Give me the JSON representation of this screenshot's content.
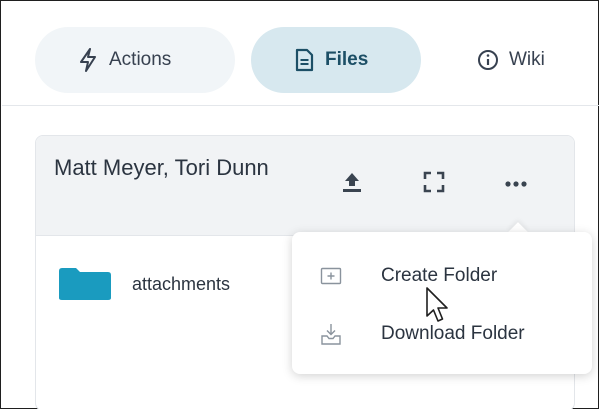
{
  "tabs": [
    {
      "label": "Actions",
      "icon": "lightning-icon",
      "active": false
    },
    {
      "label": "Files",
      "icon": "file-icon",
      "active": true
    },
    {
      "label": "Wiki",
      "icon": "info-icon",
      "active": false
    }
  ],
  "card": {
    "title": "Matt Meyer, Tori Dunn",
    "actions": [
      "upload-icon",
      "expand-icon",
      "more-icon"
    ]
  },
  "folders": [
    {
      "name": "attachments",
      "icon": "folder-icon"
    }
  ],
  "menu": {
    "items": [
      {
        "label": "Create Folder",
        "icon": "folder-plus-icon"
      },
      {
        "label": "Download Folder",
        "icon": "download-folder-icon"
      }
    ]
  },
  "colors": {
    "accent": "#1a9bbf",
    "active_tab_bg": "#d7e8ef",
    "tab_bg": "#f1f5f8",
    "card_header_bg": "#f1f3f5",
    "text": "#2b3440"
  }
}
